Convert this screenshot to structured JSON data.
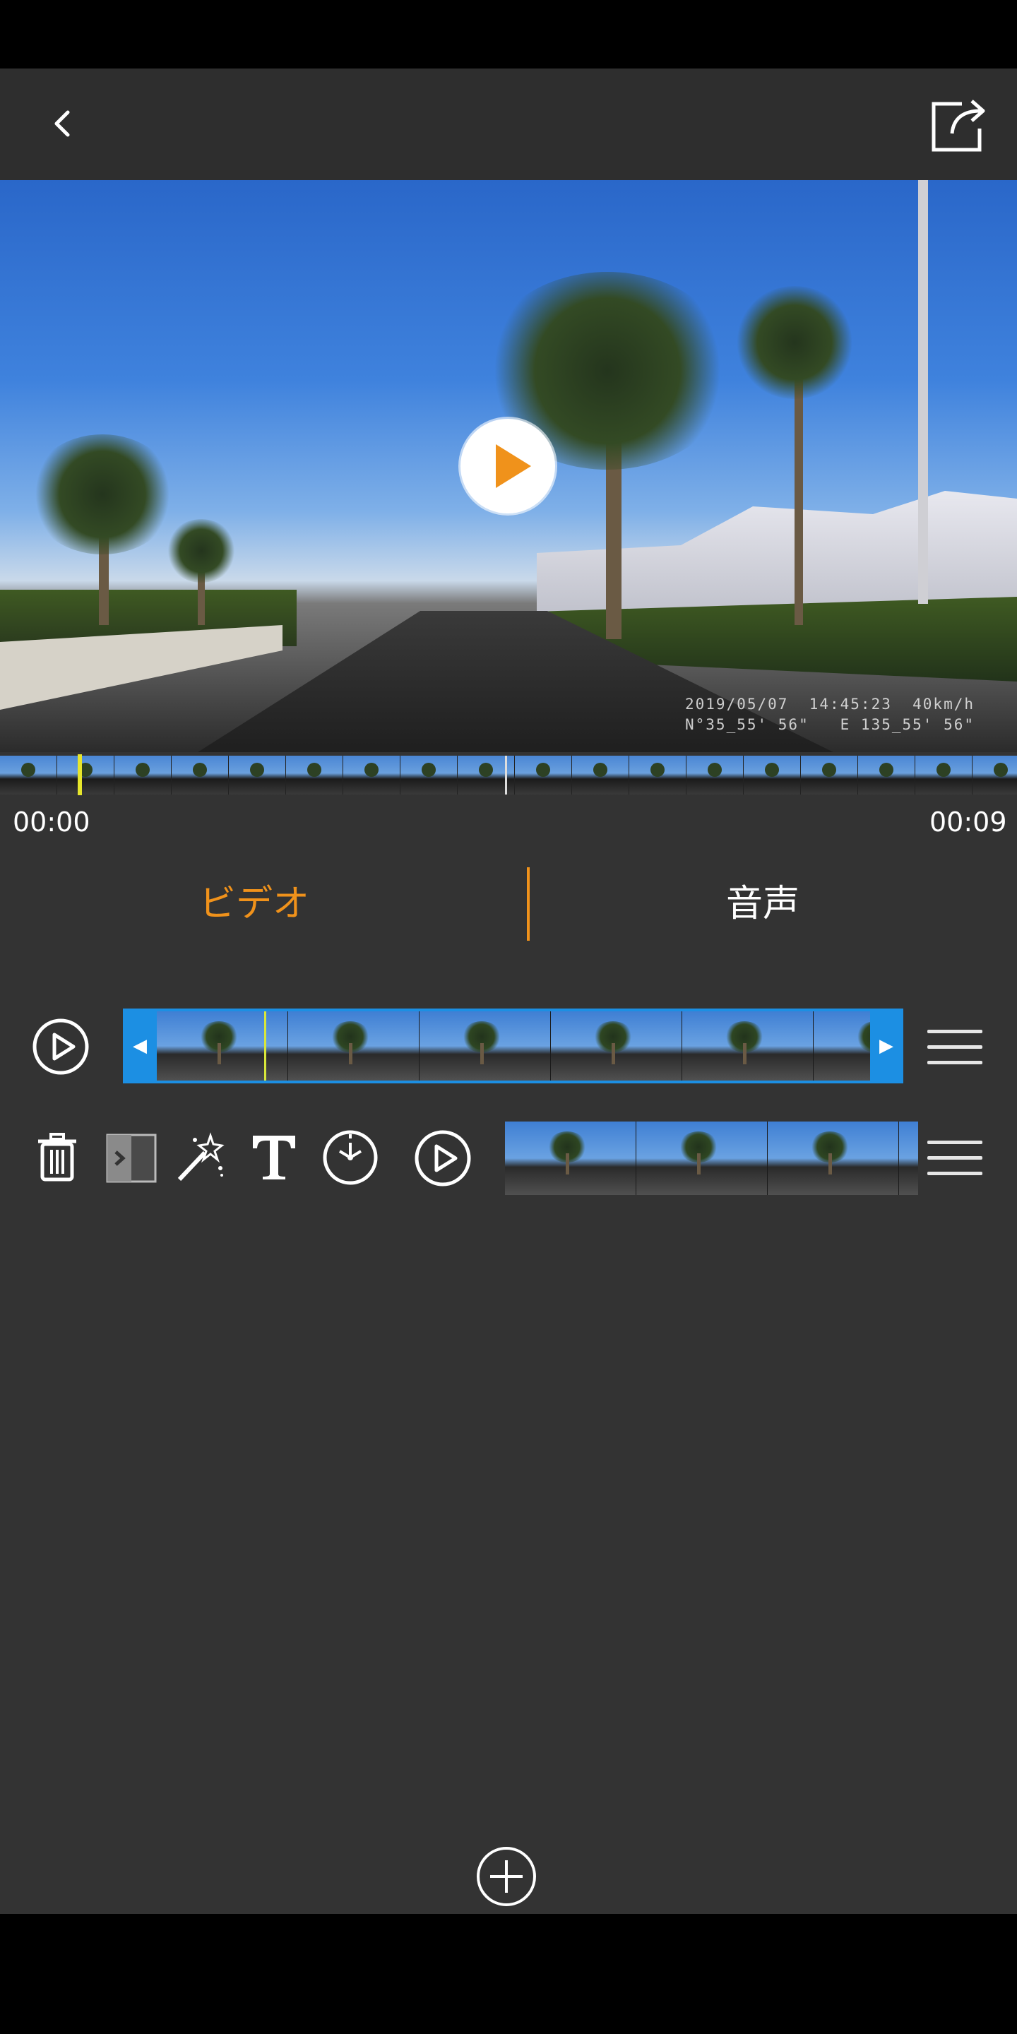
{
  "preview": {
    "overlay_line1": "2019/05/07  14:45:23  40km/h",
    "overlay_line2": "N°35_55' 56\"   E 135_55' 56\""
  },
  "timeline": {
    "start_time": "00:00",
    "end_time": "00:09"
  },
  "tabs": [
    {
      "label": "ビデオ",
      "active": true
    },
    {
      "label": "音声",
      "active": false
    }
  ],
  "colors": {
    "accent": "#f0921b",
    "clip_selected": "#1c8fe3",
    "playhead": "#e6e62c",
    "background": "#333333"
  },
  "icons": {
    "back": "chevron-left-icon",
    "share": "share-export-icon",
    "play": "play-icon",
    "delete": "trash-icon",
    "transition": "transition-icon",
    "effect": "magic-wand-icon",
    "text": "text-icon",
    "speed": "clock-icon",
    "menu": "hamburger-menu-icon",
    "add": "plus-circle-icon"
  }
}
